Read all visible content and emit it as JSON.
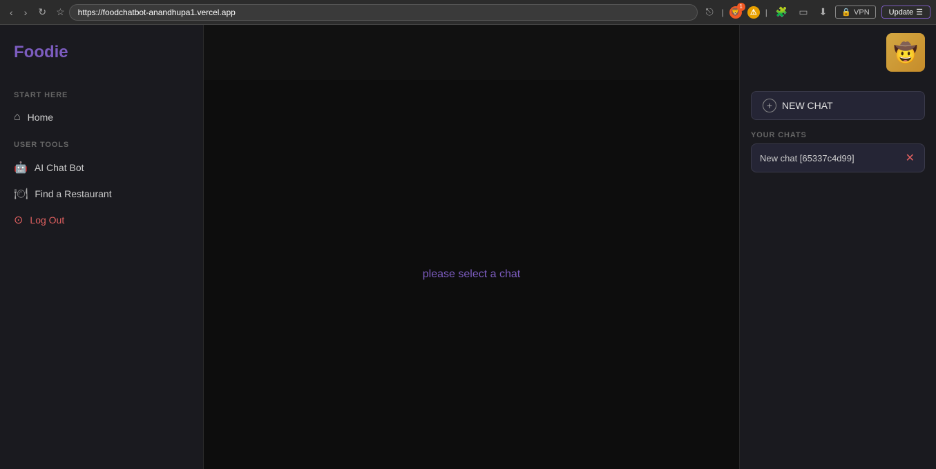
{
  "browser": {
    "url_prefix": "https://",
    "url_bold": "foodchatbot-anandhupa1.vercel.app",
    "vpn_label": "VPN",
    "update_label": "Update"
  },
  "header": {
    "logo": "Foodie",
    "avatar_emoji": "🤠"
  },
  "sidebar": {
    "start_here_label": "START HERE",
    "user_tools_label": "USER TOOLS",
    "home_label": "Home",
    "ai_chat_bot_label": "AI Chat Bot",
    "find_restaurant_label": "Find a Restaurant",
    "logout_label": "Log Out"
  },
  "main": {
    "placeholder": "please select a ",
    "placeholder_highlight": "chat"
  },
  "right_panel": {
    "new_chat_label": "NEW CHAT",
    "your_chats_label": "YOUR CHATS",
    "chat_items": [
      {
        "name": "New chat [65337c4d99]"
      }
    ]
  }
}
